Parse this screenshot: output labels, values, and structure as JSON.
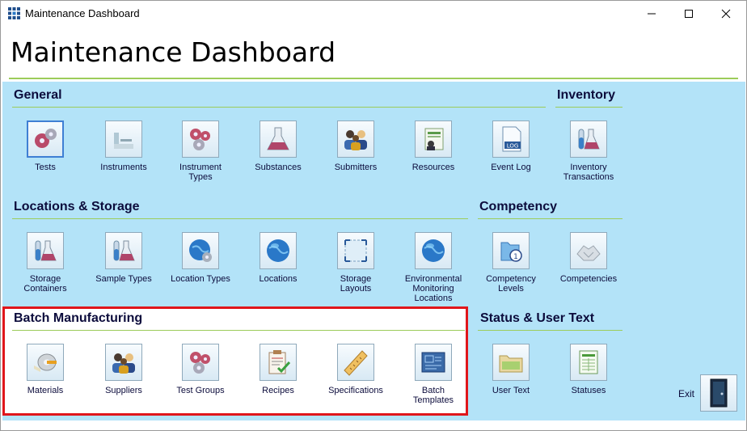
{
  "window": {
    "title": "Maintenance Dashboard"
  },
  "page": {
    "title": "Maintenance Dashboard"
  },
  "sections": {
    "general": {
      "title": "General",
      "items": [
        "Tests",
        "Instruments",
        "Instrument\nTypes",
        "Substances",
        "Submitters",
        "Resources",
        "Event Log"
      ]
    },
    "inventory": {
      "title": "Inventory",
      "items": [
        "Inventory\nTransactions"
      ]
    },
    "locations": {
      "title": "Locations & Storage",
      "items": [
        "Storage\nContainers",
        "Sample Types",
        "Location Types",
        "Locations",
        "Storage\nLayouts",
        "Environmental\nMonitoring\nLocations"
      ]
    },
    "competency": {
      "title": "Competency",
      "items": [
        "Competency\nLevels",
        "Competencies"
      ]
    },
    "batch": {
      "title": "Batch Manufacturing",
      "items": [
        "Materials",
        "Suppliers",
        "Test Groups",
        "Recipes",
        "Specifications",
        "Batch\nTemplates"
      ]
    },
    "status": {
      "title": "Status & User Text",
      "items": [
        "User Text",
        "Statuses"
      ]
    }
  },
  "exit": {
    "label": "Exit"
  },
  "colors": {
    "panel": "#b3e3f8",
    "rule": "#9ccc5a",
    "highlight": "#e0161b",
    "text": "#0c0c3c"
  }
}
